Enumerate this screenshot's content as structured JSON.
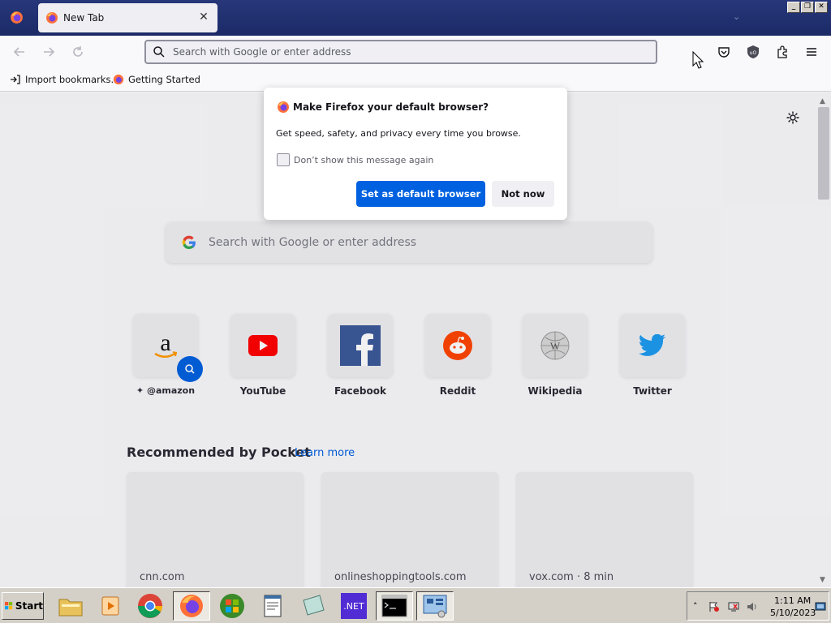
{
  "browser": {
    "tab_title": "New Tab",
    "urlbar_placeholder": "Search with Google or enter address"
  },
  "bookmarks": [
    {
      "label": "Import bookmarks...",
      "icon": "import-icon"
    },
    {
      "label": "Getting Started",
      "icon": "firefox-icon"
    }
  ],
  "newtab": {
    "search_placeholder": "Search with Google or enter address",
    "shortcuts": [
      {
        "label": "@amazon",
        "icon": "amazon-icon"
      },
      {
        "label": "YouTube",
        "icon": "youtube-icon"
      },
      {
        "label": "Facebook",
        "icon": "facebook-icon"
      },
      {
        "label": "Reddit",
        "icon": "reddit-icon"
      },
      {
        "label": "Wikipedia",
        "icon": "wikipedia-icon"
      },
      {
        "label": "Twitter",
        "icon": "twitter-icon"
      }
    ],
    "pocket": {
      "title": "Recommended by Pocket",
      "learn_more": "Learn more",
      "cards": [
        {
          "source": "cnn.com"
        },
        {
          "source": "onlineshoppingtools.com"
        },
        {
          "source": "vox.com · 8 min"
        }
      ]
    }
  },
  "dialog": {
    "title": "Make Firefox your default browser?",
    "body": "Get speed, safety, and privacy every time you browse.",
    "checkbox_label": "Don’t show this message again",
    "checkbox_checked": false,
    "primary_button": "Set as default browser",
    "secondary_button": "Not now"
  },
  "taskbar": {
    "start_label": "Start",
    "apps": [
      "file-explorer-icon",
      "media-player-icon",
      "chrome-icon",
      "firefox-icon",
      "windows-logo-icon",
      "notepad-icon",
      "paper-icon",
      "dotnet-icon",
      "terminal-icon",
      "control-panel-icon"
    ],
    "dotnet_label": ".NET",
    "clock_time": "1:11 AM",
    "clock_date": "5/10/2023"
  },
  "colors": {
    "accent": "#0061e0",
    "titlebar": "#1b2a66",
    "taskbar": "#d4d0c8"
  }
}
